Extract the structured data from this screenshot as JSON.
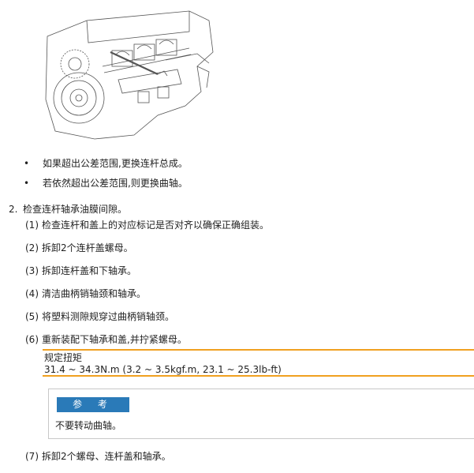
{
  "bullets": [
    "如果超出公差范围,更换连杆总成。",
    "若依然超出公差范围,则更换曲轴。"
  ],
  "bullet_symbol": "•",
  "step": {
    "num": "2.",
    "title": "检查连杆轴承油膜间隙。"
  },
  "substeps": [
    {
      "n": "(1)",
      "text": "检查连杆和盖上的对应标记是否对齐以确保正确组装。"
    },
    {
      "n": "(2)",
      "text": "拆卸2个连杆盖螺母。"
    },
    {
      "n": "(3)",
      "text": "拆卸连杆盖和下轴承。"
    },
    {
      "n": "(4)",
      "text": "清洁曲柄销轴颈和轴承。"
    },
    {
      "n": "(5)",
      "text": "将塑料测隙规穿过曲柄销轴颈。"
    },
    {
      "n": "(6)",
      "text": "重新装配下轴承和盖,并拧紧螺母。"
    },
    {
      "n": "(7)",
      "text": "拆卸2个螺母、连杆盖和轴承。"
    }
  ],
  "torque": {
    "title": "规定扭矩",
    "value": "31.4 ~ 34.3N.m (3.2 ~ 3.5kgf.m, 23.1 ~ 25.3lb-ft)"
  },
  "note": {
    "heading": "参 考",
    "text": "不要转动曲轴。"
  },
  "colors": {
    "accent": "#f0a020",
    "note_header": "#2a7ab8"
  }
}
